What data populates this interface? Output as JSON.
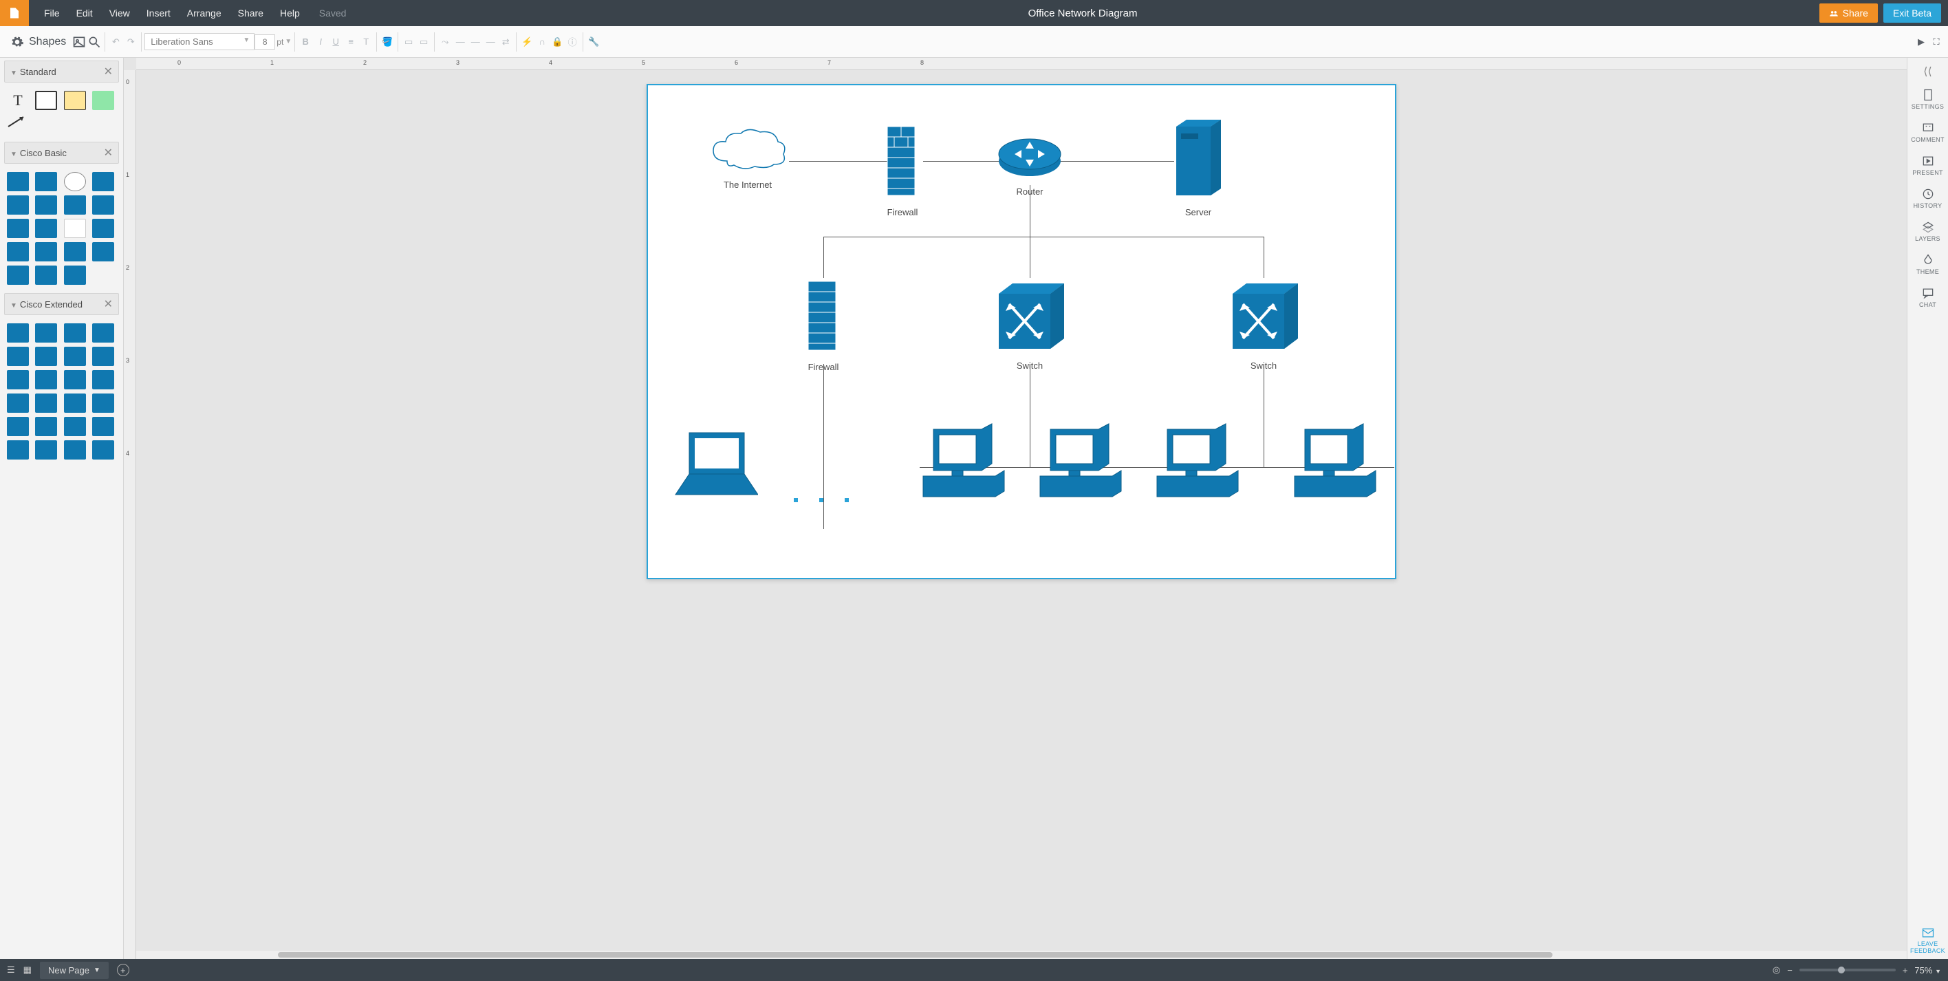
{
  "menubar": {
    "menus": [
      "File",
      "Edit",
      "View",
      "Insert",
      "Arrange",
      "Share",
      "Help"
    ],
    "saved_label": "Saved",
    "title": "Office Network Diagram",
    "share_btn": "Share",
    "exit_btn": "Exit Beta"
  },
  "toolbar": {
    "shapes_label": "Shapes",
    "font_family": "Liberation Sans",
    "font_size": "8",
    "font_unit": "pt"
  },
  "left": {
    "categories": [
      {
        "name": "Standard"
      },
      {
        "name": "Cisco Basic"
      },
      {
        "name": "Cisco Extended"
      }
    ]
  },
  "right": {
    "items": [
      {
        "id": "settings",
        "label": "SETTINGS"
      },
      {
        "id": "comment",
        "label": "COMMENT"
      },
      {
        "id": "present",
        "label": "PRESENT"
      },
      {
        "id": "history",
        "label": "HISTORY"
      },
      {
        "id": "layers",
        "label": "LAYERS"
      },
      {
        "id": "theme",
        "label": "THEME"
      },
      {
        "id": "chat",
        "label": "CHAT"
      }
    ],
    "feedback_label1": "LEAVE",
    "feedback_label2": "FEEDBACK"
  },
  "bottom": {
    "page_tab": "New Page",
    "zoom": "75%"
  },
  "canvas_nodes": {
    "internet": "The Internet",
    "firewall1": "Firewall",
    "router": "Router",
    "server": "Server",
    "firewall2": "Firewall",
    "switch1": "Switch",
    "switch2": "Switch"
  },
  "colors": {
    "brand_orange": "#f18f24",
    "brand_blue": "#2aa3d8",
    "cisco": "#1078b0",
    "chrome": "#3a434b"
  }
}
